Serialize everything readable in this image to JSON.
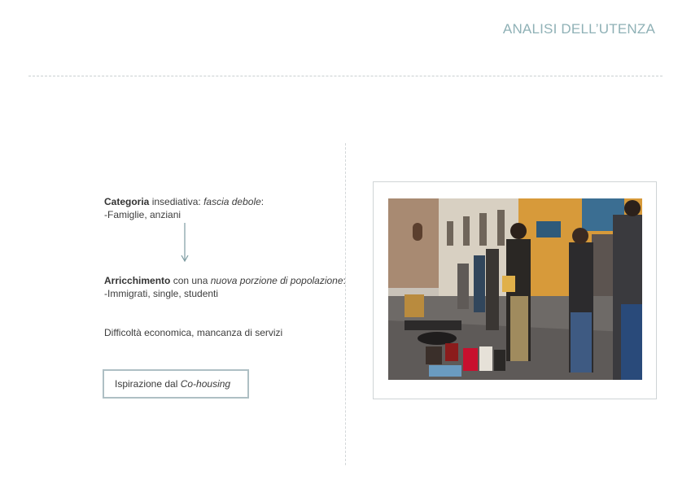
{
  "header": {
    "title": "ANALISI DELL’UTENZA"
  },
  "content": {
    "line1": {
      "bold": "Categoria",
      "text1": " insediativa: ",
      "italic": "fascia debole",
      "text2": ":"
    },
    "line1_sub": "-Famiglie, anziani",
    "line2": {
      "bold": "Arricchimento",
      "text1": " con una ",
      "italic": "nuova porzione di popolazione",
      "text2": ":"
    },
    "line2_sub": "-Immigrati, single, studenti",
    "line3": "Difficoltà economica, mancanza di servizi",
    "box": {
      "text": "Ispirazione dal ",
      "italic": "Co-housing"
    }
  },
  "colors": {
    "title": "#8fb1b6",
    "box_border": "#aebfc4",
    "arrow": "#7d9ba1"
  },
  "photo": {
    "subject": "street-vendors-photo"
  }
}
